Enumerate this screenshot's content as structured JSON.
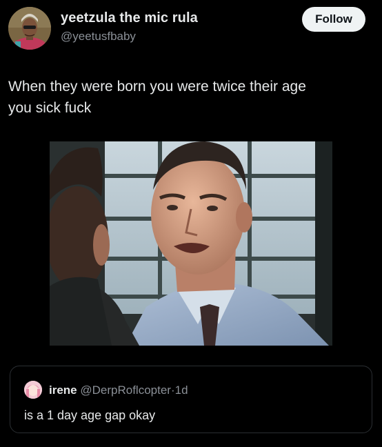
{
  "author": {
    "display_name": "yeetzula the mic rula",
    "handle": "@yeetusfbaby"
  },
  "follow_label": "Follow",
  "tweet": {
    "text": "When they were born you were twice their age\nyou sick fuck"
  },
  "quote": {
    "name": "irene",
    "handle": "@DerpRoflcopter",
    "separator": "·",
    "time": "1d",
    "text": "is a 1 day age gap okay"
  },
  "colors": {
    "background": "#000000",
    "primary_text": "#e7e9ea",
    "secondary_text": "#8b9097",
    "follow_button_bg": "#eff3f4"
  }
}
